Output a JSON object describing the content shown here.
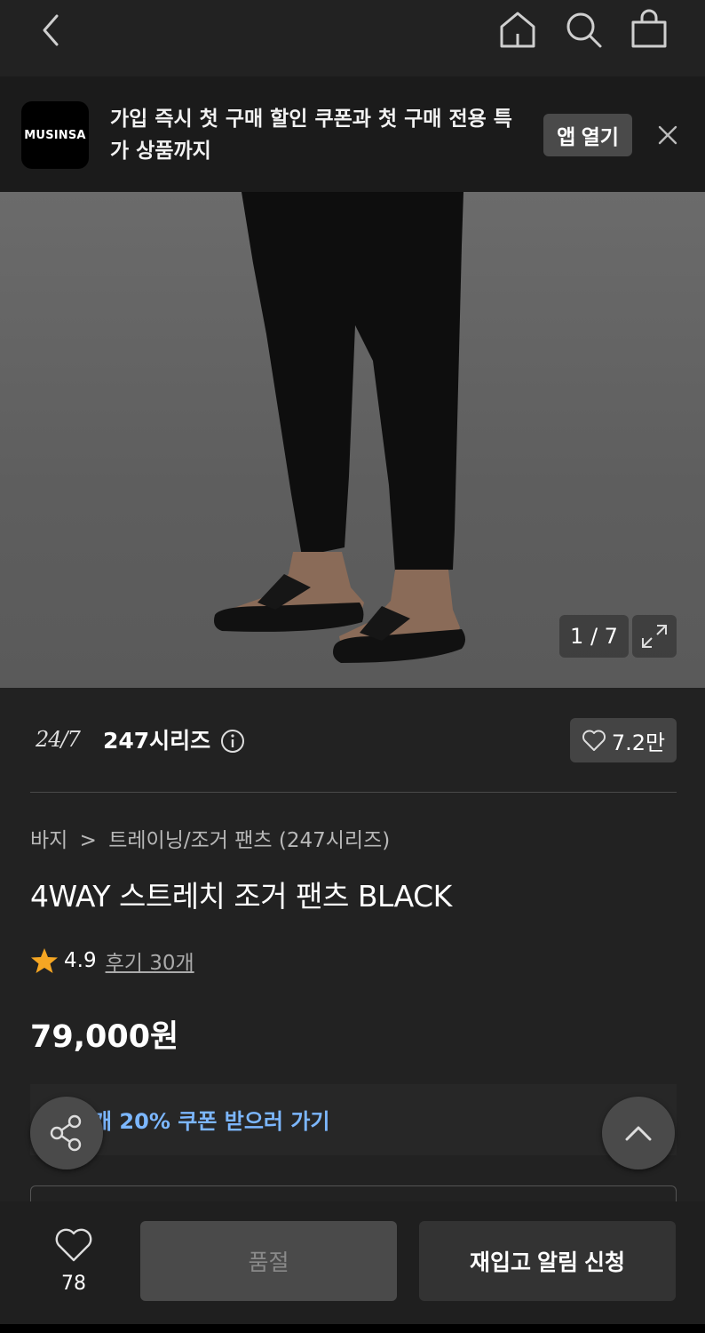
{
  "banner": {
    "logo_text": "MUSINSA",
    "message": "가입 즉시 첫 구매 할인 쿠폰과 첫 구매 전용 특가 상품까지",
    "open_label": "앱 열기"
  },
  "gallery": {
    "counter": "1 / 7"
  },
  "brand": {
    "logo_text": "24/7",
    "name": "247시리즈",
    "like_count": "7.2만"
  },
  "breadcrumb": {
    "category": "바지",
    "separator": ">",
    "subcategory": "트레이닝/조거 팬츠 (247시리즈)"
  },
  "product": {
    "title": "4WAY 스트레치 조거 팬츠 BLACK",
    "rating": "4.9",
    "reviews": "후기 30개",
    "price": "79,000원"
  },
  "coupon": {
    "text": "개 20% 쿠폰 받으러 가기"
  },
  "bottom": {
    "wish_count": "78",
    "soldout_label": "품절",
    "restock_label": "재입고 알림 신청"
  },
  "colors": {
    "background": "#222222",
    "accent_blue": "#7cb7ff",
    "star": "#f5a623"
  }
}
